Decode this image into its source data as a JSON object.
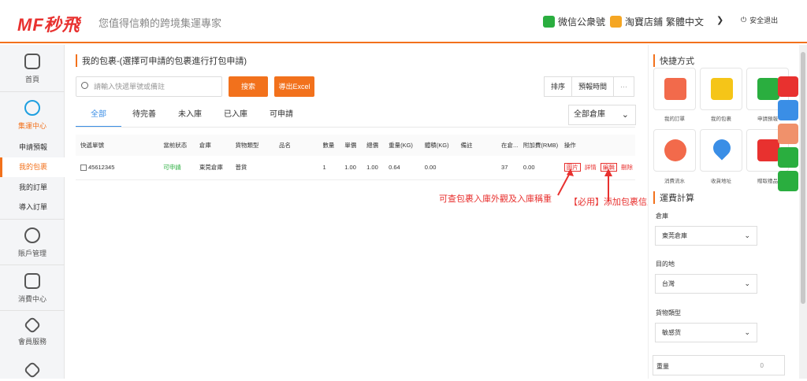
{
  "header": {
    "logo": "MF秒飛",
    "slogan": "您值得信賴的跨境集運專家",
    "wechat_label": "微信公衆號",
    "taobao_label": "淘寶店鋪",
    "language": "繁體中文",
    "logout": "安全退出"
  },
  "sidebar": {
    "home": "首頁",
    "shipping_center": "集運中心",
    "sub_items": [
      "申請預報",
      "我的包裹",
      "我的訂單",
      "導入訂單"
    ],
    "account": "賬戶管理",
    "consumption": "消費中心",
    "member": "會員服務"
  },
  "main": {
    "title": "我的包裹-(選擇可申請的包裹進行打包申請)",
    "search_placeholder": "請輸入快遞單號或備註",
    "search_btn": "搜索",
    "export_btn": "導出Excel",
    "sort_label": "排序",
    "sort_value": "預報時間",
    "sort_more": "···",
    "tabs": [
      "全部",
      "待完善",
      "未入庫",
      "已入庫",
      "可申請"
    ],
    "warehouse_select": "全部倉庫",
    "columns": [
      "快遞單號",
      "當前狀态",
      "倉庫",
      "貨物類型",
      "品名",
      "數量",
      "單價",
      "總價",
      "重量(KG)",
      "體積(KG)",
      "備註",
      "在倉...",
      "附加費(RMB)",
      "操作"
    ],
    "row": {
      "tracking": "45612345",
      "status": "可申請",
      "warehouse": "東莞倉庫",
      "type": "普貨",
      "name": "",
      "qty": "1",
      "price": "1.00",
      "total": "1.00",
      "weight": "0.64",
      "volume": "0.00",
      "note": "",
      "days": "37",
      "fee": "0.00",
      "ops": [
        "圖片",
        "詳情",
        "編輯",
        "刪除"
      ]
    },
    "annotation_1": "可查包裹入庫外觀及入庫稱重",
    "annotation_2": "【必用】添加包裹信息"
  },
  "right": {
    "quick_title": "快捷方式",
    "quick_items": [
      "我的訂單",
      "我的包裹",
      "申請預報",
      "消費流水",
      "收貨地址",
      "贈取禮品"
    ],
    "calc_title": "運費計算",
    "warehouse_label": "倉庫",
    "warehouse_value": "東莞倉庫",
    "dest_label": "目的地",
    "dest_value": "台灣",
    "cargo_label": "貨物類型",
    "cargo_value": "敏感货",
    "weight_label": "重量",
    "weight_value": "0"
  }
}
